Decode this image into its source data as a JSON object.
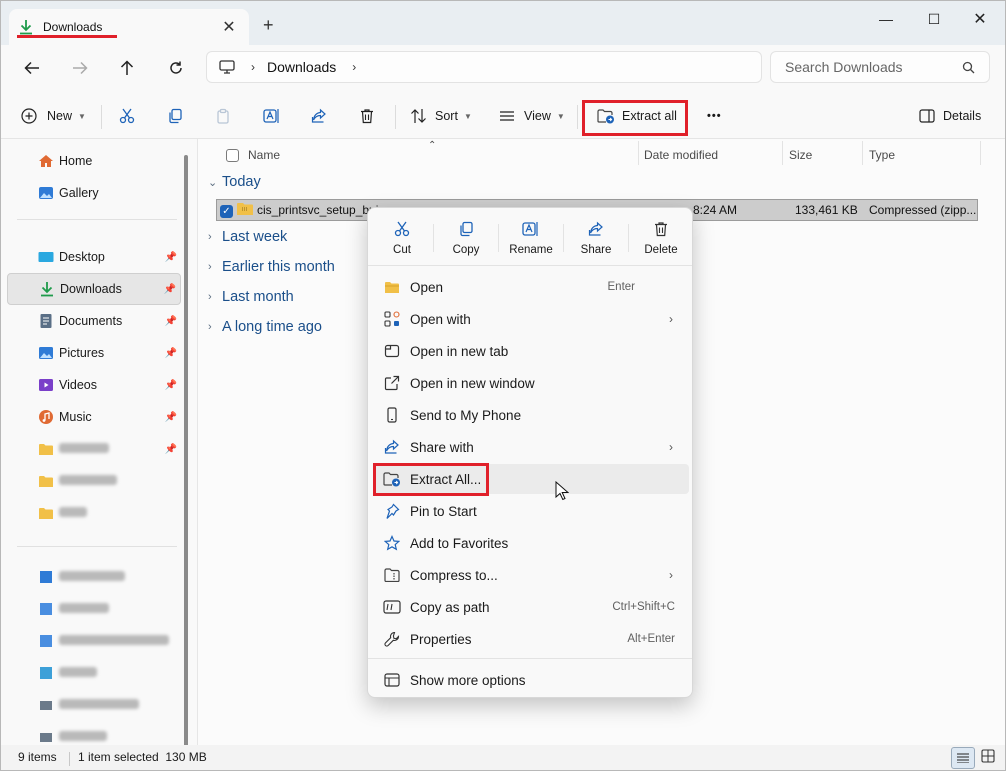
{
  "window": {
    "tab_title": "Downloads",
    "tab_close": "✕",
    "new_tab": "+",
    "minimize": "—",
    "maximize": "☐",
    "close": "✕"
  },
  "nav": {
    "breadcrumb": "Downloads",
    "search_placeholder": "Search Downloads"
  },
  "toolbar": {
    "new_label": "New",
    "sort_label": "Sort",
    "view_label": "View",
    "extract_all_label": "Extract all",
    "more_label": "•••",
    "details_label": "Details"
  },
  "sidebar": {
    "home": "Home",
    "gallery": "Gallery",
    "desktop": "Desktop",
    "downloads": "Downloads",
    "documents": "Documents",
    "pictures": "Pictures",
    "videos": "Videos",
    "music": "Music"
  },
  "columns": {
    "name": "Name",
    "date_modified": "Date modified",
    "size": "Size",
    "type": "Type"
  },
  "groups": {
    "today": "Today",
    "last_week": "Last week",
    "earlier_this_month": "Earlier this month",
    "last_month": "Last month",
    "long_time_ago": "A long time ago"
  },
  "selected_file": {
    "name": "cis_printsvc_setup_bui",
    "date": "8:24 AM",
    "size": "133,461 KB",
    "type": "Compressed (zipp..."
  },
  "status": {
    "items": "9 items",
    "selection": "1 item selected  130 MB"
  },
  "context_menu": {
    "actions": {
      "cut": "Cut",
      "copy": "Copy",
      "rename": "Rename",
      "share": "Share",
      "delete": "Delete"
    },
    "items": {
      "open": "Open",
      "open_key": "Enter",
      "open_with": "Open with",
      "open_new_tab": "Open in new tab",
      "open_new_window": "Open in new window",
      "send_phone": "Send to My Phone",
      "share_with": "Share with",
      "extract_all": "Extract All...",
      "pin_start": "Pin to Start",
      "add_favorites": "Add to Favorites",
      "compress_to": "Compress to...",
      "copy_path": "Copy as path",
      "copy_path_key": "Ctrl+Shift+C",
      "properties": "Properties",
      "properties_key": "Alt+Enter",
      "show_more": "Show more options"
    }
  },
  "colors": {
    "accent": "#1e63b8",
    "highlight_box": "#e0202a",
    "group_text": "#1b4f8a"
  }
}
